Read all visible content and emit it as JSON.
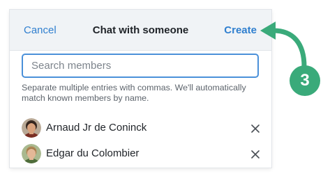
{
  "header": {
    "cancel_label": "Cancel",
    "title": "Chat with someone",
    "create_label": "Create"
  },
  "search": {
    "placeholder": "Search members",
    "value": ""
  },
  "help_text": "Separate multiple entries with commas. We'll automatically match known members by name.",
  "members": [
    {
      "name": "Arnaud Jr de Coninck",
      "avatar": "avatar-photo",
      "remove_icon": "close-icon"
    },
    {
      "name": "Edgar du Colombier",
      "avatar": "avatar-photo",
      "remove_icon": "close-icon"
    }
  ],
  "annotation": {
    "step_number": "3",
    "color": "#3aaa7a"
  },
  "colors": {
    "accent": "#2f7fcf",
    "input_border": "#4a90d9",
    "header_background": "#f0f3f6"
  }
}
